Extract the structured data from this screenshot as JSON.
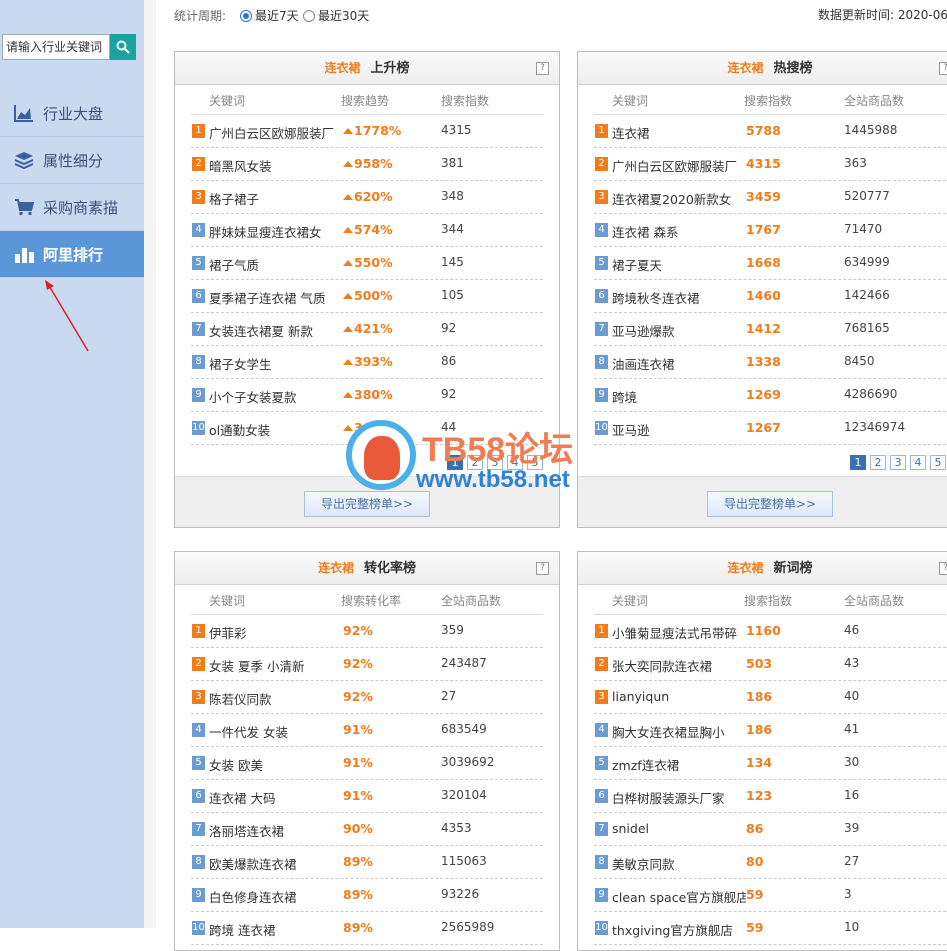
{
  "search": {
    "placeholder": "请输入行业关键词"
  },
  "sidebar": {
    "items": [
      {
        "label": "行业大盘",
        "icon": "area-chart-icon"
      },
      {
        "label": "属性细分",
        "icon": "layers-icon"
      },
      {
        "label": "采购商素描",
        "icon": "cart-icon"
      },
      {
        "label": "阿里排行",
        "icon": "bar-chart-icon",
        "active": true
      }
    ]
  },
  "topbar": {
    "period_label": "统计周期:",
    "option_7": "最近7天",
    "option_30": "最近30天",
    "selected": "最近7天",
    "update_text": "数据更新时间: 2020-06"
  },
  "panels": {
    "rising": {
      "category": "连衣裙",
      "title": "上升榜",
      "headers": [
        "关键词",
        "搜索趋势",
        "搜索指数"
      ],
      "rows": [
        {
          "no": "1",
          "kw": "广州白云区欧娜服装厂",
          "v1": "1778%",
          "v2": "4315"
        },
        {
          "no": "2",
          "kw": "暗黑风女装",
          "v1": "958%",
          "v2": "381"
        },
        {
          "no": "3",
          "kw": "格子裙子",
          "v1": "620%",
          "v2": "348"
        },
        {
          "no": "4",
          "kw": "胖妹妹显瘦连衣裙女",
          "v1": "574%",
          "v2": "344"
        },
        {
          "no": "5",
          "kw": "裙子气质",
          "v1": "550%",
          "v2": "145"
        },
        {
          "no": "6",
          "kw": "夏季裙子连衣裙 气质",
          "v1": "500%",
          "v2": "105"
        },
        {
          "no": "7",
          "kw": "女装连衣裙夏 新款",
          "v1": "421%",
          "v2": "92"
        },
        {
          "no": "8",
          "kw": "裙子女学生",
          "v1": "393%",
          "v2": "86"
        },
        {
          "no": "9",
          "kw": "小个子女装夏款",
          "v1": "380%",
          "v2": "92"
        },
        {
          "no": "10",
          "kw": "ol通勤女装",
          "v1": "369%",
          "v2": "44"
        }
      ],
      "pages": [
        "1",
        "2",
        "3",
        "4",
        "5"
      ],
      "export_label": "导出完整榜单>>"
    },
    "hot": {
      "category": "连衣裙",
      "title": "热搜榜",
      "headers": [
        "关键词",
        "搜索指数",
        "全站商品数"
      ],
      "rows": [
        {
          "no": "1",
          "kw": "连衣裙",
          "v1": "5788",
          "v2": "1445988"
        },
        {
          "no": "2",
          "kw": "广州白云区欧娜服装厂",
          "v1": "4315",
          "v2": "363"
        },
        {
          "no": "3",
          "kw": "连衣裙夏2020新款女",
          "v1": "3459",
          "v2": "520777"
        },
        {
          "no": "4",
          "kw": "连衣裙 森系",
          "v1": "1767",
          "v2": "71470"
        },
        {
          "no": "5",
          "kw": "裙子夏天",
          "v1": "1668",
          "v2": "634999"
        },
        {
          "no": "6",
          "kw": "跨境秋冬连衣裙",
          "v1": "1460",
          "v2": "142466"
        },
        {
          "no": "7",
          "kw": "亚马逊爆款",
          "v1": "1412",
          "v2": "768165"
        },
        {
          "no": "8",
          "kw": "油画连衣裙",
          "v1": "1338",
          "v2": "8450"
        },
        {
          "no": "9",
          "kw": "跨境",
          "v1": "1269",
          "v2": "4286690"
        },
        {
          "no": "10",
          "kw": "亚马逊",
          "v1": "1267",
          "v2": "12346974"
        }
      ],
      "pages": [
        "1",
        "2",
        "3",
        "4",
        "5"
      ],
      "export_label": "导出完整榜单>>"
    },
    "conversion": {
      "category": "连衣裙",
      "title": "转化率榜",
      "headers": [
        "关键词",
        "搜索转化率",
        "全站商品数"
      ],
      "rows": [
        {
          "no": "1",
          "kw": "伊菲彩",
          "v1": "92%",
          "v2": "359"
        },
        {
          "no": "2",
          "kw": "女装 夏季 小清新",
          "v1": "92%",
          "v2": "243487"
        },
        {
          "no": "3",
          "kw": "陈若仪同款",
          "v1": "92%",
          "v2": "27"
        },
        {
          "no": "4",
          "kw": "一件代发 女装",
          "v1": "91%",
          "v2": "683549"
        },
        {
          "no": "5",
          "kw": "女装 欧美",
          "v1": "91%",
          "v2": "3039692"
        },
        {
          "no": "6",
          "kw": "连衣裙 大码",
          "v1": "91%",
          "v2": "320104"
        },
        {
          "no": "7",
          "kw": "洛丽塔连衣裙",
          "v1": "90%",
          "v2": "4353"
        },
        {
          "no": "8",
          "kw": "欧美爆款连衣裙",
          "v1": "89%",
          "v2": "115063"
        },
        {
          "no": "9",
          "kw": "白色修身连衣裙",
          "v1": "89%",
          "v2": "93226"
        },
        {
          "no": "10",
          "kw": "跨境 连衣裙",
          "v1": "89%",
          "v2": "2565989"
        }
      ]
    },
    "newwords": {
      "category": "连衣裙",
      "title": "新词榜",
      "headers": [
        "关键词",
        "搜索指数",
        "全站商品数"
      ],
      "rows": [
        {
          "no": "1",
          "kw": "小雏菊显瘦法式吊带碎",
          "v1": "1160",
          "v2": "46"
        },
        {
          "no": "2",
          "kw": "张大奕同款连衣裙",
          "v1": "503",
          "v2": "43"
        },
        {
          "no": "3",
          "kw": "lianyiqun",
          "v1": "186",
          "v2": "40"
        },
        {
          "no": "4",
          "kw": "胸大女连衣裙显胸小",
          "v1": "186",
          "v2": "41"
        },
        {
          "no": "5",
          "kw": "zmzf连衣裙",
          "v1": "134",
          "v2": "30"
        },
        {
          "no": "6",
          "kw": "白桦树服装源头厂家",
          "v1": "123",
          "v2": "16"
        },
        {
          "no": "7",
          "kw": "snidel",
          "v1": "86",
          "v2": "39"
        },
        {
          "no": "8",
          "kw": "美敏京同款",
          "v1": "80",
          "v2": "27"
        },
        {
          "no": "9",
          "kw": "clean space官方旗舰店",
          "v1": "59",
          "v2": "3"
        },
        {
          "no": "10",
          "kw": "thxgiving官方旗舰店",
          "v1": "59",
          "v2": "10"
        }
      ]
    }
  },
  "watermark": {
    "title": "TB58论坛",
    "url": "www.tb58.net"
  },
  "colors": {
    "accent_orange": "#f07d1c",
    "sidebar_bg": "#c9daf0",
    "active_blue": "#5b96d9"
  }
}
